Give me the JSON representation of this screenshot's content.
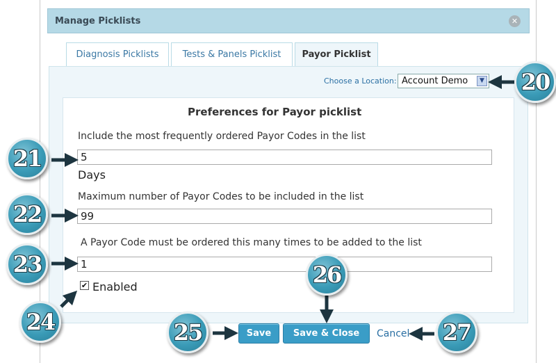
{
  "dialog": {
    "title": "Manage Picklists",
    "close_icon": "close-icon"
  },
  "tabs": [
    {
      "label": "Diagnosis Picklists",
      "active": false
    },
    {
      "label": "Tests & Panels Picklist",
      "active": false
    },
    {
      "label": "Payor Picklist",
      "active": true
    }
  ],
  "location": {
    "label": "Choose a Location:",
    "value": "Account Demo"
  },
  "form": {
    "heading": "Preferences for Payor picklist",
    "frequent_label": "Include the most frequently ordered Payor Codes in the list",
    "frequent_value": "5",
    "days_label": "Days",
    "max_label": "Maximum number of Payor Codes to be included in the list",
    "max_value": "99",
    "times_label": "A Payor Code must be ordered this many times to be added to the list",
    "times_value": "1",
    "enabled_label": "Enabled",
    "enabled_checked": true
  },
  "buttons": {
    "save": "Save",
    "save_close": "Save & Close",
    "cancel": "Cancel"
  },
  "callouts": [
    "20",
    "21",
    "22",
    "23",
    "24",
    "25",
    "26",
    "27"
  ],
  "colors": {
    "titlebar": "#b5d9e6",
    "button": "#3a9dc7",
    "callout": "#3a9bb7",
    "link": "#2a6fa3"
  }
}
